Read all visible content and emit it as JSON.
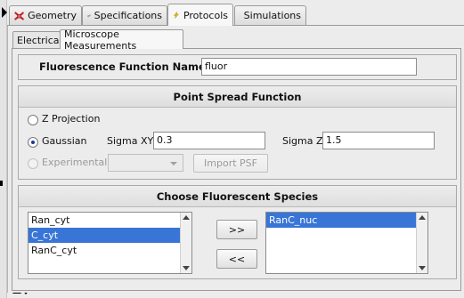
{
  "top_tabs": [
    {
      "label": "Geometry",
      "icon": "geometry-icon"
    },
    {
      "label": "Specifications",
      "icon": "gear-icon"
    },
    {
      "label": "Protocols",
      "icon": "lightning-icon"
    },
    {
      "label": "Simulations",
      "icon": "runner-icon"
    }
  ],
  "sub_tabs": [
    {
      "label": "Electrical"
    },
    {
      "label": "Microscope Measurements"
    }
  ],
  "function_name": {
    "label": "Fluorescence Function Name",
    "value": "fluor"
  },
  "psf": {
    "title": "Point Spread Function",
    "z_projection_label": "Z Projection",
    "gaussian_label": "Gaussian",
    "sigma_xy_label": "Sigma XY",
    "sigma_xy_value": "0.3",
    "sigma_z_label": "Sigma Z",
    "sigma_z_value": "1.5",
    "experimental_label": "Experimental",
    "experimental_selected": "",
    "import_psf_label": "Import PSF",
    "selected_option": "Gaussian"
  },
  "species": {
    "title": "Choose Fluorescent Species",
    "available": [
      "Ran_cyt",
      "C_cyt",
      "RanC_cyt"
    ],
    "available_selected": "C_cyt",
    "chosen": [
      "RanC_nuc"
    ],
    "chosen_selected": "RanC_nuc",
    "add_label": ">>",
    "remove_label": "<<"
  },
  "colors": {
    "selection": "#3875d7",
    "radio_dot": "#1a3a8a",
    "geometry_icon": "#d42020",
    "gear_icon": "#5a7fa8",
    "lightning_icon": "#e8b800"
  }
}
